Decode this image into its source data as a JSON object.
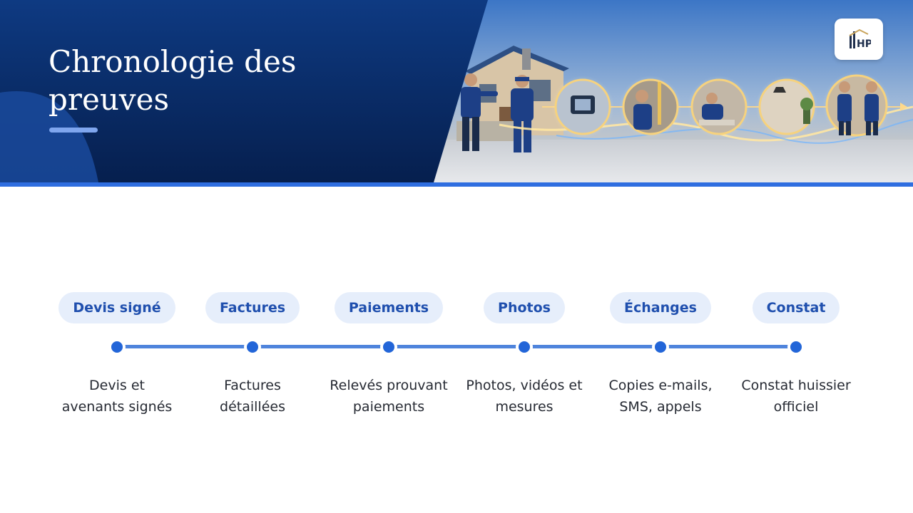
{
  "header": {
    "title": "Chronologie des preuves",
    "logo_text": "HP"
  },
  "colors": {
    "header_navy": "#0b2e6e",
    "accent_blue": "#2265d8",
    "pill_bg": "#e6eefb",
    "pill_text": "#1f4fae"
  },
  "timeline": {
    "steps": [
      {
        "label": "Devis signé",
        "description": "Devis et\navenants signés"
      },
      {
        "label": "Factures",
        "description": "Factures\ndétaillées"
      },
      {
        "label": "Paiements",
        "description": "Relevés prouvant\npaiements"
      },
      {
        "label": "Photos",
        "description": "Photos, vidéos et\nmesures"
      },
      {
        "label": "Échanges",
        "description": "Copies e-mails,\nSMS, appels"
      },
      {
        "label": "Constat",
        "description": "Constat huissier\nofficiel"
      }
    ]
  }
}
